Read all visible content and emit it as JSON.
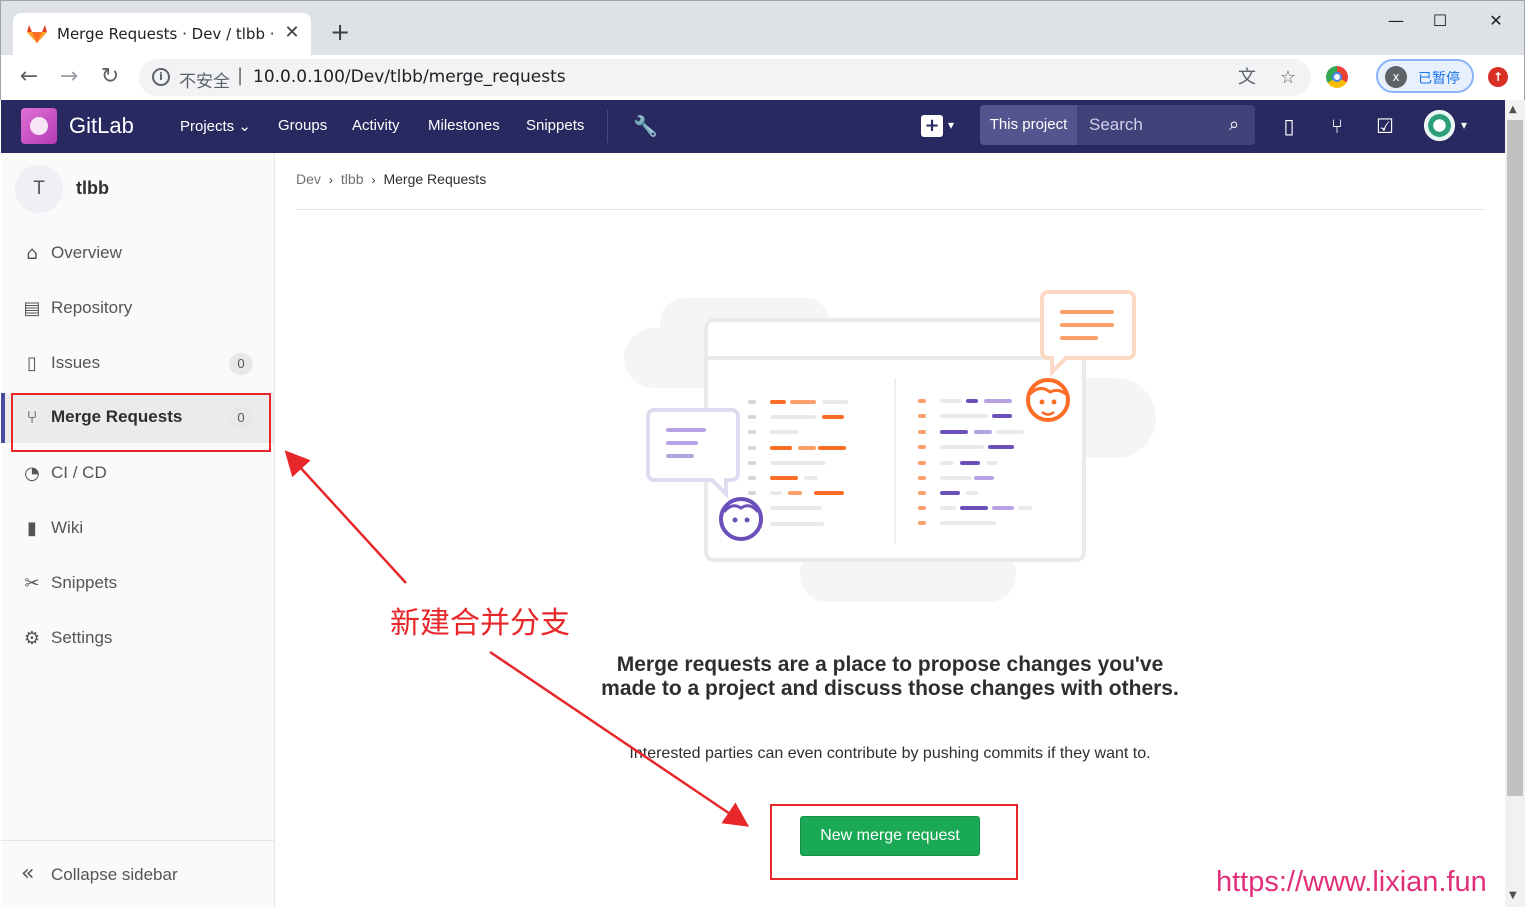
{
  "browser": {
    "tab_title": "Merge Requests · Dev / tlbb · ",
    "tab_close": "✕",
    "new_tab": "+",
    "window_controls": {
      "minimize": "—",
      "maximize": "☐",
      "close": "✕"
    },
    "insecure_label": "不安全",
    "url_separator": "|",
    "url": "10.0.0.100/Dev/tlbb/merge_requests",
    "profile_initial": "x",
    "profile_status": "已暂停",
    "icons": [
      "back-icon",
      "forward-icon",
      "reload-icon",
      "info-icon",
      "translate-icon",
      "star-icon",
      "chrome-extension-icon",
      "update-icon"
    ]
  },
  "header": {
    "brand": "GitLab",
    "nav": [
      {
        "label": "Projects",
        "has_caret": true
      },
      {
        "label": "Groups"
      },
      {
        "label": "Activity"
      },
      {
        "label": "Milestones"
      },
      {
        "label": "Snippets"
      }
    ],
    "search_scope": "This project",
    "search_placeholder": "Search",
    "colors": {
      "header_bg": "#292961",
      "search_bg": "#42427a"
    }
  },
  "sidebar": {
    "project_initial": "T",
    "project_name": "tlbb",
    "items": [
      {
        "label": "Overview",
        "icon": "home-icon"
      },
      {
        "label": "Repository",
        "icon": "document-icon"
      },
      {
        "label": "Issues",
        "icon": "issues-icon",
        "count": "0"
      },
      {
        "label": "Merge Requests",
        "icon": "merge-request-icon",
        "count": "0",
        "active": true
      },
      {
        "label": "CI / CD",
        "icon": "rocket-icon"
      },
      {
        "label": "Wiki",
        "icon": "book-icon"
      },
      {
        "label": "Snippets",
        "icon": "scissors-icon"
      },
      {
        "label": "Settings",
        "icon": "gear-icon"
      }
    ],
    "collapse_label": "Collapse sidebar"
  },
  "breadcrumb": {
    "items": [
      "Dev",
      "tlbb"
    ],
    "current": "Merge Requests",
    "separator": "›"
  },
  "empty_state": {
    "title": "Merge requests are a place to propose changes you've made to a project and discuss those changes with others.",
    "description": "Interested parties can even contribute by pushing commits if they want to.",
    "button": "New merge request",
    "colors": {
      "button_bg": "#1aaa55",
      "accent_orange": "#fc6d26",
      "accent_purple": "#6b4fbb"
    }
  },
  "annotation": {
    "text": "新建合并分支",
    "color": "#e8272b"
  },
  "watermark": "https://www.lixian.fun"
}
